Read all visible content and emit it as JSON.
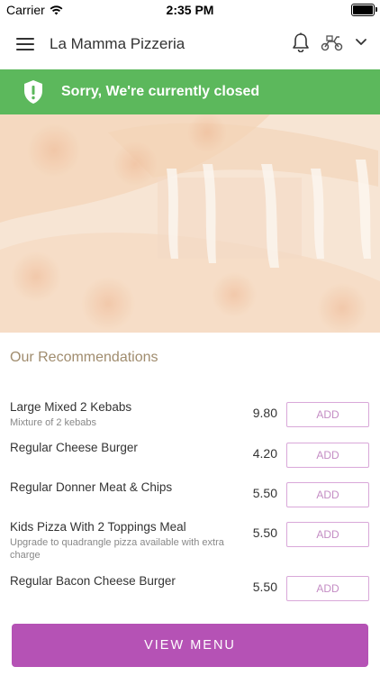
{
  "status_bar": {
    "carrier": "Carrier",
    "time": "2:35 PM"
  },
  "nav": {
    "title": "La Mamma Pizzeria"
  },
  "banner": {
    "text": "Sorry, We're currently closed",
    "color": "#5cb85c"
  },
  "recommendations": {
    "title": "Our Recommendations",
    "add_label": "ADD",
    "items": [
      {
        "name": "Large Mixed 2 Kebabs",
        "desc": "Mixture of 2 kebabs",
        "price": "9.80"
      },
      {
        "name": "Regular Cheese Burger",
        "desc": "",
        "price": "4.20"
      },
      {
        "name": "Regular Donner Meat & Chips",
        "desc": "",
        "price": "5.50"
      },
      {
        "name": "Kids Pizza With 2 Toppings Meal",
        "desc": "Upgrade to quadrangle pizza available with extra charge",
        "price": "5.50"
      },
      {
        "name": "Regular Bacon Cheese Burger",
        "desc": "",
        "price": "5.50"
      }
    ]
  },
  "view_menu": {
    "label": "VIEW MENU",
    "color": "#b552b5"
  },
  "icons": {
    "menu": "hamburger-icon",
    "bell": "bell-icon",
    "delivery": "scooter-icon",
    "dropdown": "chevron-down-icon",
    "banner": "shield-exclamation-icon"
  }
}
